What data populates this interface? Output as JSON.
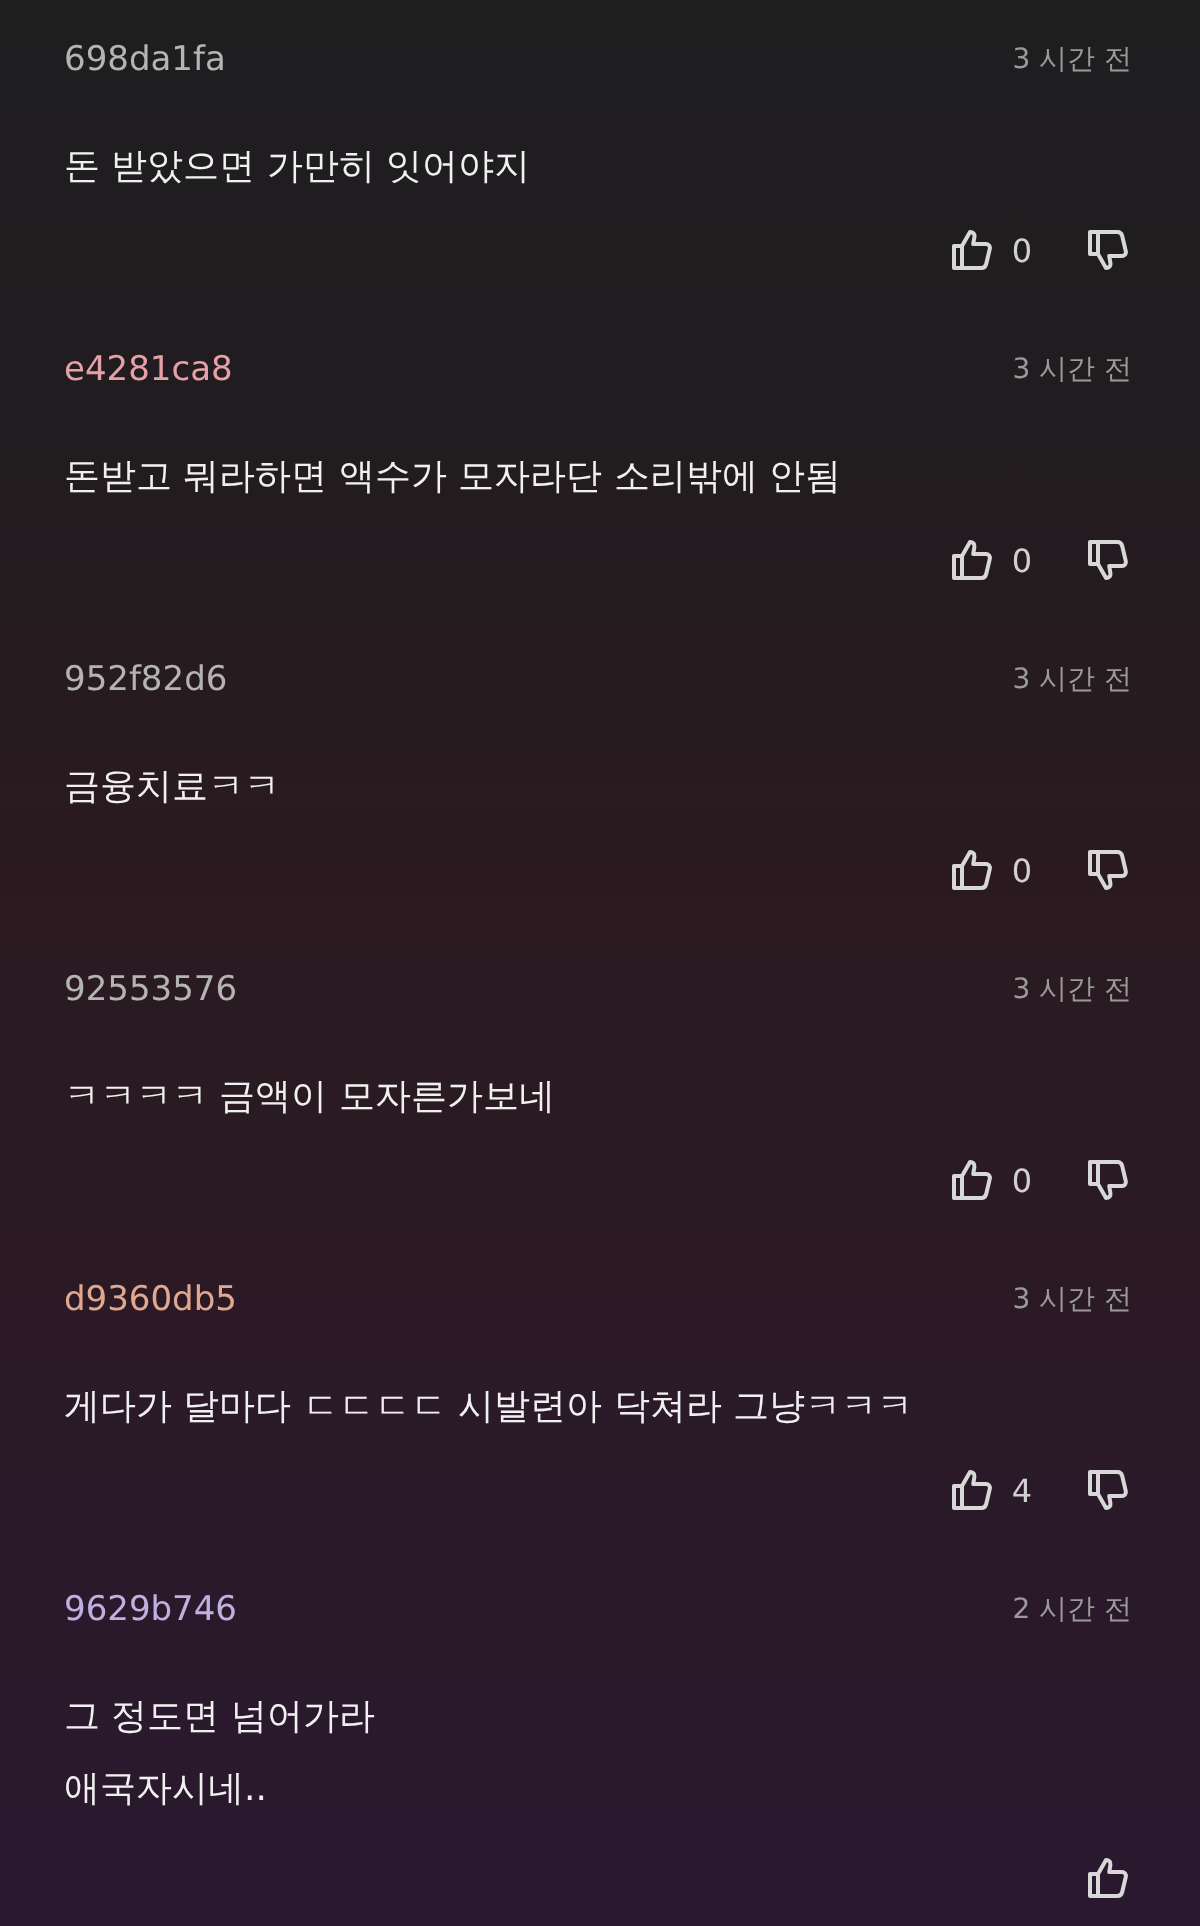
{
  "comments": [
    {
      "author": "698da1fa",
      "color": "#b4b4b4",
      "time": "3 시간 전",
      "text": "돈 받았으면 가만히 잇어야지",
      "likes": "0",
      "dislike_shown": true
    },
    {
      "author": "e4281ca8",
      "color": "#e8a0a8",
      "time": "3 시간 전",
      "text": "돈받고 뭐라하면 액수가 모자라단 소리밖에 안됨",
      "likes": "0",
      "dislike_shown": true
    },
    {
      "author": "952f82d6",
      "color": "#b4b4b4",
      "time": "3 시간 전",
      "text": "금융치료ㅋㅋ",
      "likes": "0",
      "dislike_shown": true
    },
    {
      "author": "92553576",
      "color": "#b4b4b4",
      "time": "3 시간 전",
      "text": "ㅋㅋㅋㅋ 금액이 모자른가보네",
      "likes": "0",
      "dislike_shown": true
    },
    {
      "author": "d9360db5",
      "color": "#e0a890",
      "time": "3 시간 전",
      "text": "게다가 달마다 ㄷㄷㄷㄷ 시발련아 닥쳐라 그냥ㅋㅋㅋ",
      "likes": "4",
      "dislike_shown": true
    },
    {
      "author": "9629b746",
      "color": "#c0b0e0",
      "time": "2 시간 전",
      "text": "그 정도면 넘어가라\n애국자시네..",
      "dislike_shown": false
    }
  ]
}
